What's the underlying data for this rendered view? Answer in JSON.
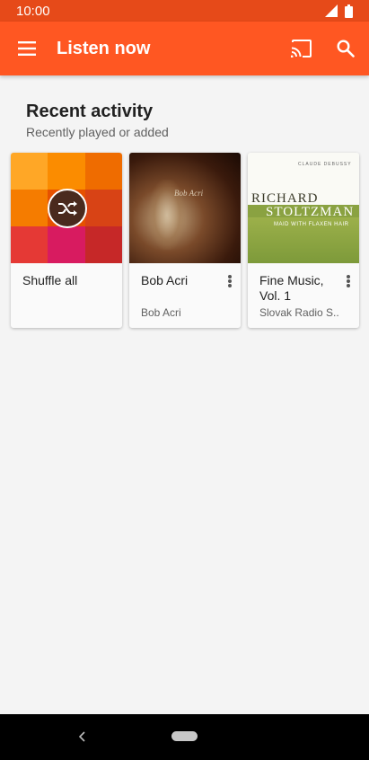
{
  "status_bar": {
    "time": "10:00"
  },
  "app_bar": {
    "title": "Listen now",
    "icons": [
      "menu-icon",
      "cast-icon",
      "search-icon"
    ]
  },
  "section": {
    "title": "Recent activity",
    "subtitle": "Recently played or added"
  },
  "cards": [
    {
      "title": "Shuffle all",
      "subtitle": "",
      "icon": "shuffle-icon"
    },
    {
      "title": "Bob Acri",
      "subtitle": "Bob Acri"
    },
    {
      "title": "Fine Music, Vol. 1",
      "subtitle": "Slovak Radio S.."
    }
  ],
  "album_art": {
    "bob": {
      "cover_text": "Bob Acri"
    },
    "fine": {
      "header": "CLAUDE DEBUSSY",
      "line1": "RICHARD",
      "line2": "STOLTZMAN",
      "line3": "MAID WITH FLAXEN HAIR"
    }
  },
  "colors": {
    "status_bar": "#e64a19",
    "app_bar": "#ff5722",
    "background": "#f4f4f4",
    "mosaic": [
      "#ffa726",
      "#fb8c00",
      "#ef6c00",
      "#f57c00",
      "#e65100",
      "#d84315",
      "#e53935",
      "#d81b60",
      "#c62828"
    ]
  }
}
